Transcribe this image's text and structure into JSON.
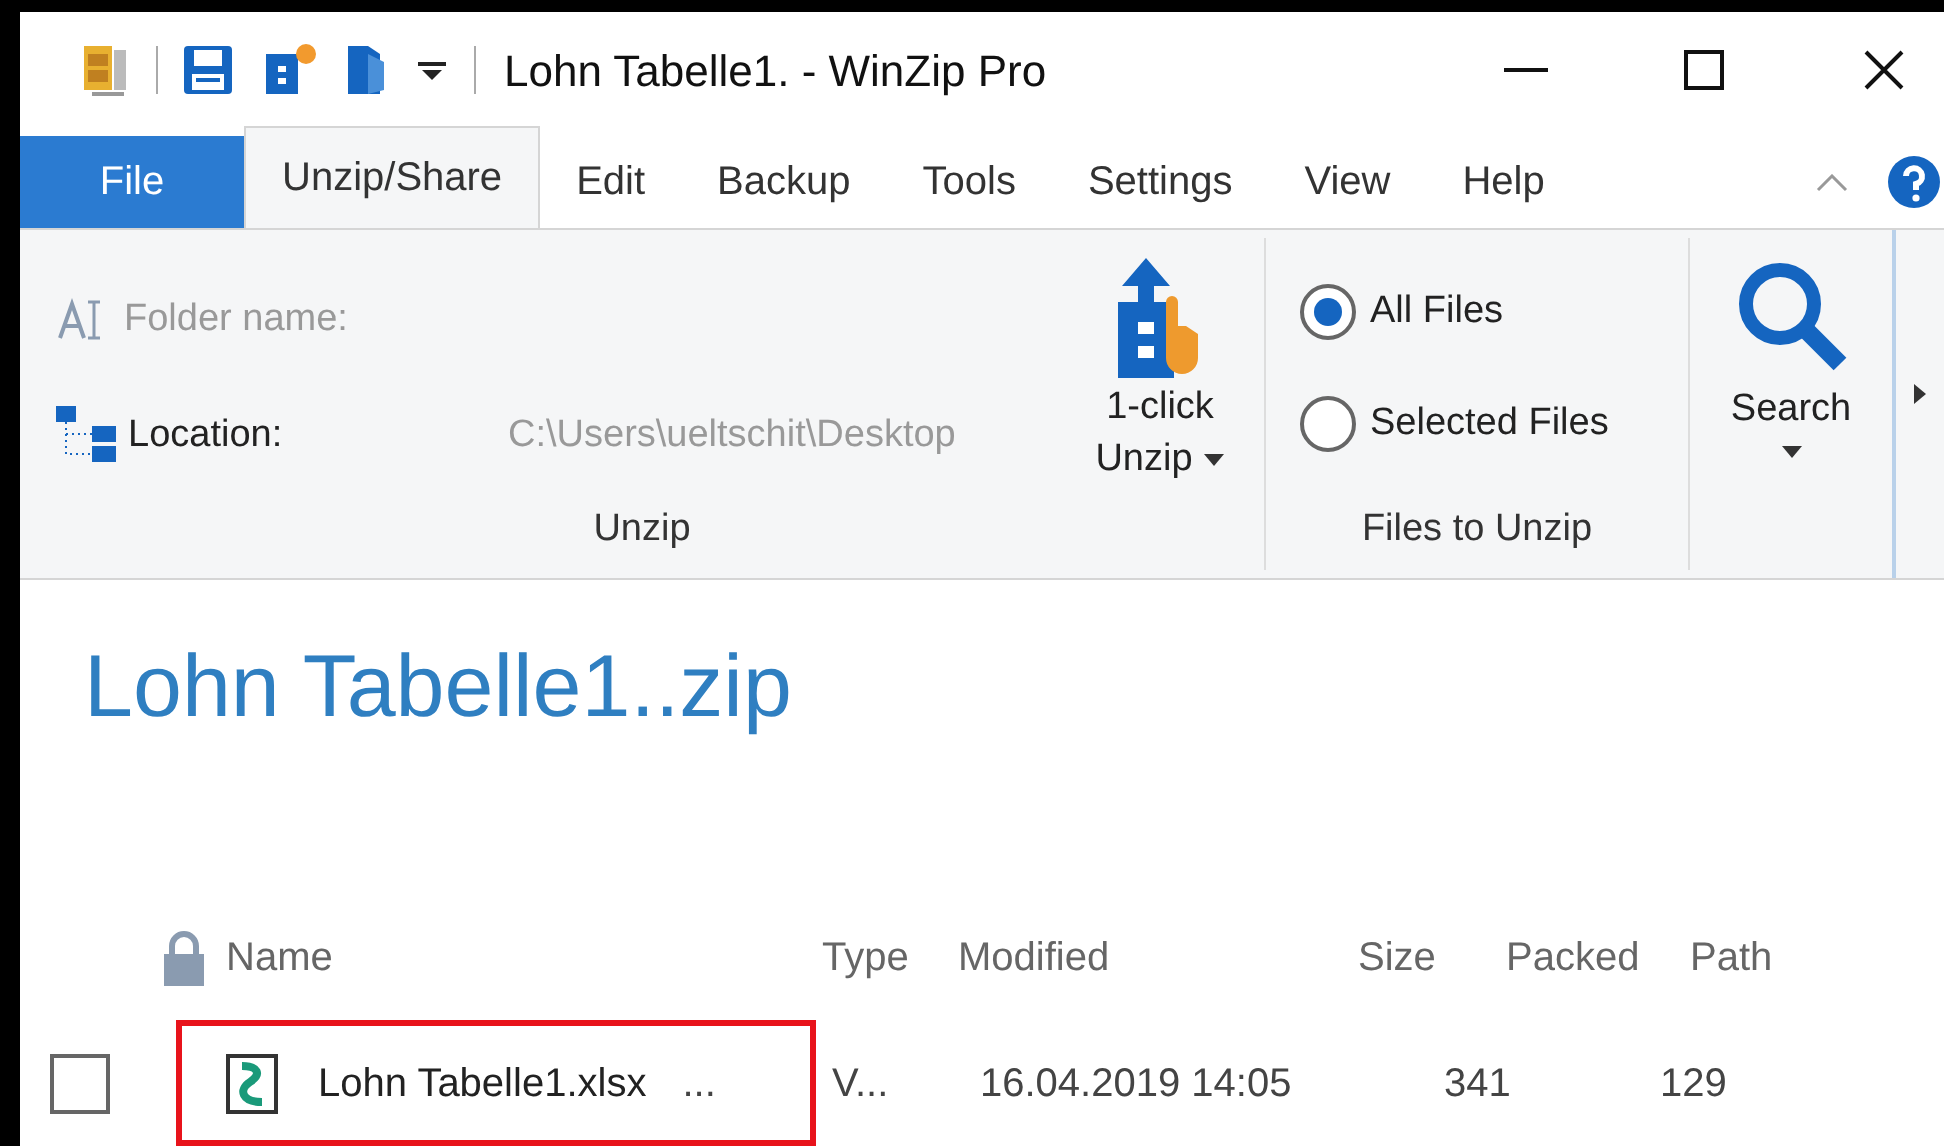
{
  "window": {
    "title": "Lohn Tabelle1. - WinZip Pro"
  },
  "tabs": [
    {
      "label": "File",
      "kind": "file",
      "selected": false
    },
    {
      "label": "Unzip/Share",
      "kind": "tab",
      "selected": true
    },
    {
      "label": "Edit",
      "kind": "tab",
      "selected": false
    },
    {
      "label": "Backup",
      "kind": "tab",
      "selected": false
    },
    {
      "label": "Tools",
      "kind": "tab",
      "selected": false
    },
    {
      "label": "Settings",
      "kind": "tab",
      "selected": false
    },
    {
      "label": "View",
      "kind": "tab",
      "selected": false
    },
    {
      "label": "Help",
      "kind": "tab",
      "selected": false
    }
  ],
  "ribbon": {
    "unzip_group": {
      "label": "Unzip",
      "folder_name_label": "Folder name:",
      "location_label": "Location:",
      "location_value": "C:\\Users\\ueltschit\\Desktop",
      "one_click": {
        "line1": "1-click",
        "line2": "Unzip"
      }
    },
    "files_group": {
      "label": "Files to Unzip",
      "options": [
        {
          "label": "All Files",
          "selected": true
        },
        {
          "label": "Selected Files",
          "selected": false
        }
      ]
    },
    "search": {
      "label": "Search"
    }
  },
  "archive_title": "Lohn Tabelle1..zip",
  "table": {
    "columns": [
      "Name",
      "Type",
      "Modified",
      "Size",
      "Packed",
      "Path"
    ],
    "rows": [
      {
        "checked": false,
        "highlighted": true,
        "name": "Lohn Tabelle1.xlsx",
        "ellipsis": "...",
        "type": "V...",
        "modified": "16.04.2019 14:05",
        "size": "341",
        "packed": "129"
      }
    ]
  }
}
